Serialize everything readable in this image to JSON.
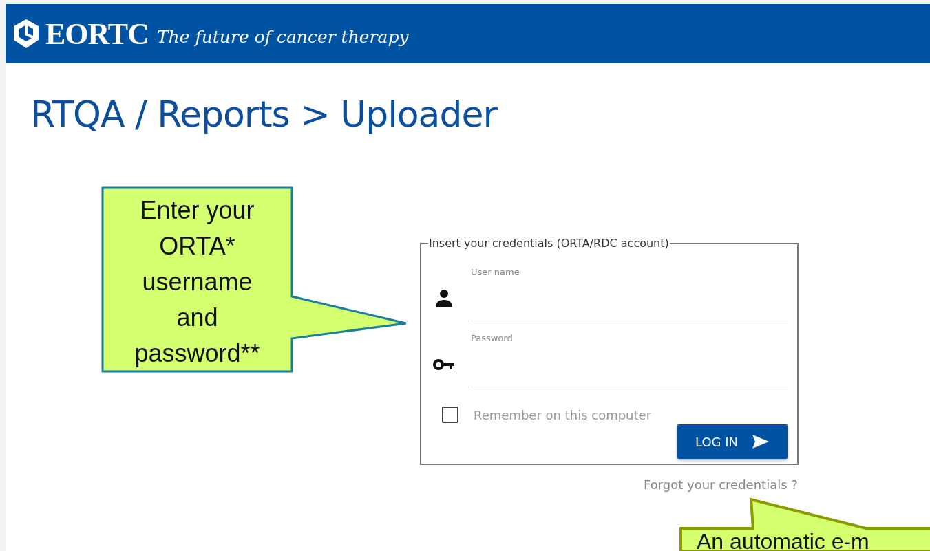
{
  "header": {
    "logo": "EORTC",
    "tagline": "The future of cancer therapy"
  },
  "title": "RTQA / Reports > Uploader",
  "login": {
    "legend": "Insert your credentials (ORTA/RDC account)",
    "fields": [
      {
        "kind": "user",
        "label": "User name"
      },
      {
        "kind": "password",
        "label": "Password"
      }
    ],
    "remember": {
      "label": "Remember on this computer",
      "checked": false
    },
    "button": "LOG IN",
    "forgot_link": "Forgot your credentials ?"
  },
  "callouts": [
    {
      "kind": "left",
      "text": "Enter your ORTA* username and password**"
    },
    {
      "kind": "bottom",
      "text": "An automatic e-m"
    }
  ]
}
